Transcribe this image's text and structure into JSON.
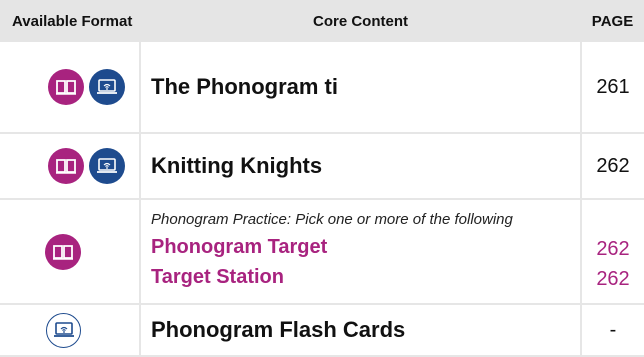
{
  "headers": {
    "format": "Available Format",
    "content": "Core Content",
    "page": "PAGE"
  },
  "rows": [
    {
      "title": "The Phonogram ti",
      "page": "261",
      "formats": [
        "book-icon",
        "web-icon"
      ]
    },
    {
      "title": "Knitting Knights",
      "page": "262",
      "formats": [
        "book-icon",
        "web-icon"
      ]
    },
    {
      "note": "Phonogram Practice: Pick one or more of the following",
      "options": [
        {
          "title": "Phonogram Target",
          "page": "262"
        },
        {
          "title": "Target Station",
          "page": "262"
        }
      ],
      "formats": [
        "book-icon"
      ]
    },
    {
      "title": "Phonogram Flash Cards",
      "page": "-",
      "formats": [
        "web-icon"
      ]
    }
  ],
  "colors": {
    "book": "#a8237f",
    "web": "#1e4b8e",
    "accent_text": "#a8237f",
    "header_bg": "#e5e5e5"
  }
}
